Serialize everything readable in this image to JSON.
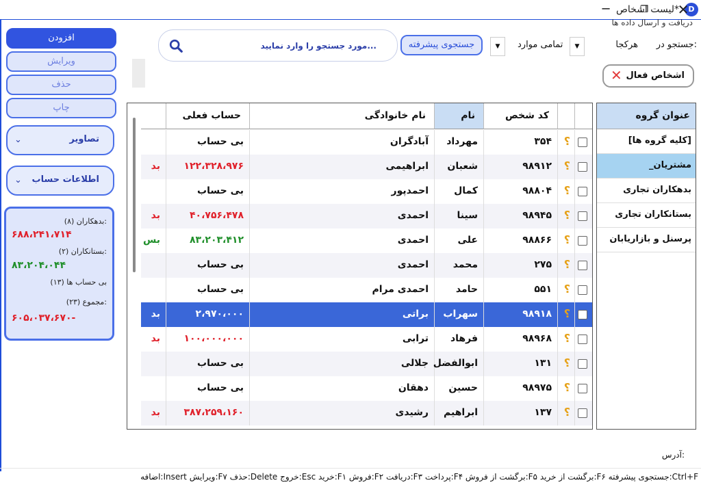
{
  "window": {
    "title": "لیست اشخاص*",
    "app_icon": "app-logo-icon",
    "minimize_glyph": "─",
    "maximize_glyph": "❐",
    "close_glyph": "✕"
  },
  "header": {
    "sync_text": "دریافت و ارسال داده ها",
    "search_in_label": "جستجو در:",
    "search_in_value": "هرکجا",
    "scope_value": "تمامی موارد",
    "dropdown_glyph": "▼",
    "advanced_search_label": "جستجوی پیشرفته",
    "search_placeholder": "مورد جستجو را وارد نمایید...",
    "active_persons_label": "اشخاص فعال",
    "active_x_glyph": "✕"
  },
  "actions": {
    "add": "افزودن",
    "edit": "ویرایش",
    "delete": "حذف",
    "print": "چاپ",
    "images": "تصاویر",
    "account_info": "اطلاعات حساب",
    "chevron": "⌄"
  },
  "summary": {
    "debtors_label": "بدهکاران (۸):",
    "debtors_value": "۶۸۸،۲۴۱،۷۱۴",
    "creditors_label": "بستانکاران (۲):",
    "creditors_value": "۸۳،۲۰۴،۰۴۴",
    "no_account_label": "بی حساب ها (۱۳)",
    "total_label": "مجموع (۲۳):",
    "total_value": "۶۰۵،۰۳۷،۶۷۰-"
  },
  "groups": {
    "header": "عنوان گروه",
    "items": [
      "[کلیه گروه ها]",
      "_مشتریان",
      "بدهکاران تجاری",
      "بستانکاران تجاری",
      "پرسنل و بازاریابان"
    ],
    "selected_index": 1
  },
  "table": {
    "columns": [
      "کد شخص",
      "نام",
      "نام خانوادگی",
      "حساب فعلی"
    ],
    "question_glyph": "؟",
    "rows": [
      {
        "code": "۳۵۴",
        "name": "مهرداد",
        "family": "آبادگران",
        "account": "بی حساب",
        "status": "",
        "tone": "none"
      },
      {
        "code": "۹۸۹۱۲",
        "name": "شعبان",
        "family": "ابراهیمی",
        "account": "۱۲۲،۳۲۸،۹۷۶",
        "status": "بد",
        "tone": "red"
      },
      {
        "code": "۹۸۸۰۴",
        "name": "کمال",
        "family": "احمدپور",
        "account": "بی حساب",
        "status": "",
        "tone": "none"
      },
      {
        "code": "۹۸۹۴۵",
        "name": "سینا",
        "family": "احمدی",
        "account": "۴۰،۷۵۶،۴۷۸",
        "status": "بد",
        "tone": "red"
      },
      {
        "code": "۹۸۸۶۶",
        "name": "علی",
        "family": "احمدی",
        "account": "۸۳،۲۰۳،۴۱۲",
        "status": "بس",
        "tone": "green"
      },
      {
        "code": "۲۷۵",
        "name": "محمد",
        "family": "احمدی",
        "account": "بی حساب",
        "status": "",
        "tone": "none"
      },
      {
        "code": "۵۵۱",
        "name": "حامد",
        "family": "احمدی مرام",
        "account": "بی حساب",
        "status": "",
        "tone": "none"
      },
      {
        "code": "۹۸۹۱۸",
        "name": "سهراب",
        "family": "براتی",
        "account": "۲،۹۷۰،۰۰۰",
        "status": "بد",
        "tone": "selected"
      },
      {
        "code": "۹۸۹۶۸",
        "name": "فرهاد",
        "family": "ترابی",
        "account": "۱۰۰،۰۰۰،۰۰۰",
        "status": "بد",
        "tone": "red"
      },
      {
        "code": "۱۳۱",
        "name": "ابوالفضل",
        "family": "جلالی",
        "account": "بی حساب",
        "status": "",
        "tone": "none"
      },
      {
        "code": "۹۸۹۷۵",
        "name": "حسین",
        "family": "دهقان",
        "account": "بی حساب",
        "status": "",
        "tone": "none"
      },
      {
        "code": "۱۳۷",
        "name": "ابراهیم",
        "family": "رشیدی",
        "account": "۳۸۷،۲۵۹،۱۶۰",
        "status": "بد",
        "tone": "red"
      }
    ]
  },
  "footer": {
    "address_label": "آدرس:",
    "shortcuts": "اضافه:Insert  ویرایش:F۷  حذف:Delete  خروج:Esc  خرید:F۱  فروش:F۲  دریافت:F۳  پرداخت:F۴  برگشت از فروش:F۵  برگشت از خرید:F۶  جستجوی پیشرفته:Ctrl+F"
  }
}
